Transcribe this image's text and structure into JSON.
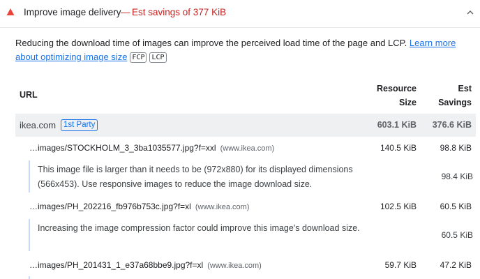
{
  "header": {
    "title": "Improve image delivery",
    "dash": "—",
    "savings": "Est savings of 377 KiB",
    "colors": {
      "warning": "#e8453c",
      "savings_text": "#c5221f"
    }
  },
  "description": {
    "text": "Reducing the download time of images can improve the perceived load time of the page and LCP.",
    "link": "Learn more about optimizing image size",
    "metrics": [
      "FCP",
      "LCP"
    ]
  },
  "table": {
    "headers": {
      "url": "URL",
      "resource_size": "Resource Size",
      "est_savings": "Est Savings"
    },
    "group": {
      "name": "ikea.com",
      "badge": "1st Party",
      "size": "603.1 KiB",
      "savings": "376.6 KiB"
    },
    "rows": [
      {
        "url": "…images/STOCKHOLM_3_3ba1035577.jpg?f=xxl",
        "domain": "(www.ikea.com)",
        "size": "140.5 KiB",
        "savings": "98.8 KiB",
        "detail": "This image file is larger than it needs to be (972x880) for its displayed dimensions (566x453). Use responsive images to reduce the image download size.",
        "detail_savings": "98.4 KiB"
      },
      {
        "url": "…images/PH_202216_fb976b753c.jpg?f=xl",
        "domain": "(www.ikea.com)",
        "size": "102.5 KiB",
        "savings": "60.5 KiB",
        "detail": "Increasing the image compression factor could improve this image's download size.",
        "detail_savings": "60.5 KiB"
      },
      {
        "url": "…images/PH_201431_1_e37a68bbe9.jpg?f=xl",
        "domain": "(www.ikea.com)",
        "size": "59.7 KiB",
        "savings": "47.2 KiB"
      }
    ]
  }
}
